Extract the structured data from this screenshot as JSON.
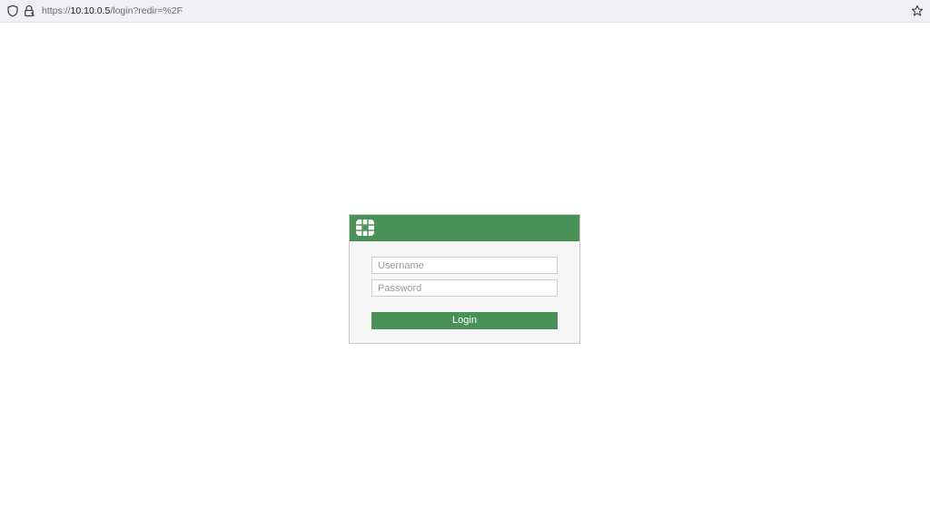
{
  "browser": {
    "url_prefix": "https://",
    "url_host": "10.10.0.5",
    "url_path": "/login?redir=%2F",
    "icons": [
      "shield-icon",
      "lock-icon",
      "bookmark-star-icon"
    ]
  },
  "login": {
    "logo": "fortinet-logo-icon",
    "username_placeholder": "Username",
    "password_placeholder": "Password",
    "button_label": "Login",
    "accent_color": "#4a9158"
  }
}
